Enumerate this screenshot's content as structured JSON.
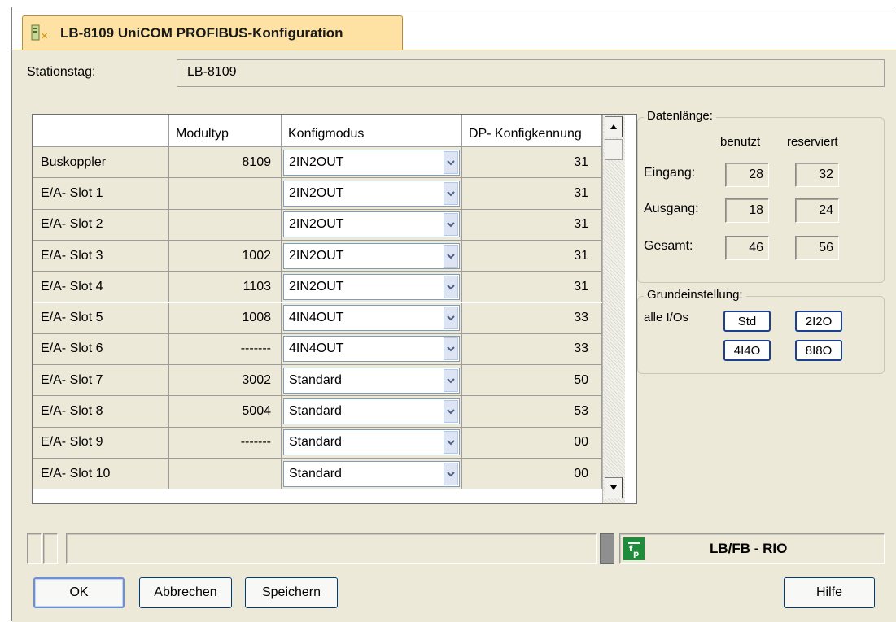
{
  "window": {
    "tab_title": "LB-8109 UniCOM PROFIBUS-Konfiguration"
  },
  "station": {
    "label": "Stationstag:",
    "value": "LB-8109"
  },
  "grid": {
    "headers": [
      "",
      "Modultyp",
      "Konfigmodus",
      "DP- Konfigkennung"
    ],
    "rows": [
      {
        "label": "Buskoppler",
        "modultyp": "8109",
        "konfigmodus": "2IN2OUT",
        "dp": "31"
      },
      {
        "label": "E/A- Slot 1",
        "modultyp": "",
        "konfigmodus": "2IN2OUT",
        "dp": "31"
      },
      {
        "label": "E/A- Slot 2",
        "modultyp": "",
        "konfigmodus": "2IN2OUT",
        "dp": "31"
      },
      {
        "label": "E/A- Slot 3",
        "modultyp": "1002",
        "konfigmodus": "2IN2OUT",
        "dp": "31"
      },
      {
        "label": "E/A- Slot 4",
        "modultyp": "1103",
        "konfigmodus": "2IN2OUT",
        "dp": "31"
      },
      {
        "label": "E/A- Slot 5",
        "modultyp": "1008",
        "konfigmodus": "4IN4OUT",
        "dp": "33"
      },
      {
        "label": "E/A- Slot 6",
        "modultyp": "-------",
        "konfigmodus": "4IN4OUT",
        "dp": "33"
      },
      {
        "label": "E/A- Slot 7",
        "modultyp": "3002",
        "konfigmodus": "Standard",
        "dp": "50"
      },
      {
        "label": "E/A- Slot 8",
        "modultyp": "5004",
        "konfigmodus": "Standard",
        "dp": "53"
      },
      {
        "label": "E/A- Slot 9",
        "modultyp": "-------",
        "konfigmodus": "Standard",
        "dp": "00"
      },
      {
        "label": "E/A- Slot 10",
        "modultyp": "",
        "konfigmodus": "Standard",
        "dp": "00"
      }
    ]
  },
  "datenlaenge": {
    "title": "Datenlänge:",
    "col_used": "benutzt",
    "col_reserved": "reserviert",
    "rows": [
      {
        "label": "Eingang:",
        "used": "28",
        "reserved": "32"
      },
      {
        "label": "Ausgang:",
        "used": "18",
        "reserved": "24"
      },
      {
        "label": "Gesamt:",
        "used": "46",
        "reserved": "56"
      }
    ]
  },
  "grundeinstellung": {
    "title": "Grundeinstellung:",
    "label": "alle I/Os",
    "buttons": [
      "Std",
      "2I2O",
      "4I4O",
      "8I8O"
    ]
  },
  "status": {
    "brand_text": "LB/FB - RIO",
    "logo_glyph": "f̄p"
  },
  "buttons": {
    "ok": "OK",
    "cancel": "Abbrechen",
    "save": "Speichern",
    "help": "Hilfe"
  },
  "colors": {
    "tab_bg": "#fde2a3",
    "dialog_bg": "#ece9d8",
    "button_border": "#1d3f8f",
    "logo_green": "#1e8c3a"
  }
}
